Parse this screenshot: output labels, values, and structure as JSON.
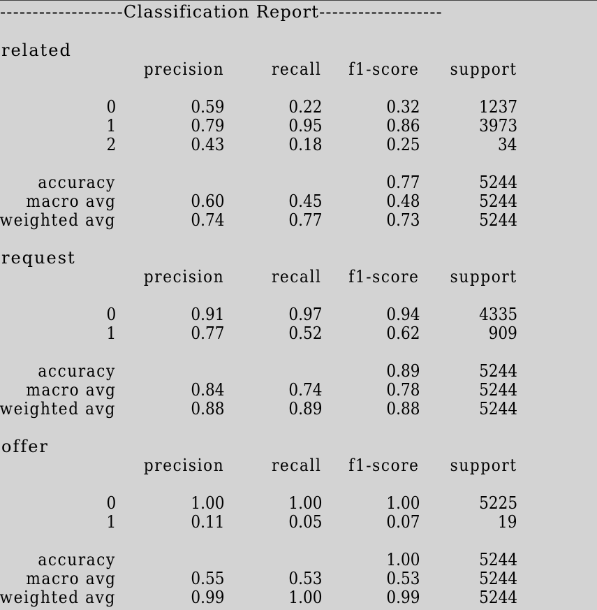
{
  "window": {
    "background": "#d3d3d3"
  },
  "report": {
    "title_line": "-------------------Classification Report-------------------",
    "header": {
      "precision": "precision",
      "recall": "recall",
      "f1": "f1-score",
      "support": "support"
    },
    "sections": [
      {
        "name": "related",
        "classes": [
          {
            "label": "0",
            "precision": "0.59",
            "recall": "0.22",
            "f1": "0.32",
            "support": "1237"
          },
          {
            "label": "1",
            "precision": "0.79",
            "recall": "0.95",
            "f1": "0.86",
            "support": "3973"
          },
          {
            "label": "2",
            "precision": "0.43",
            "recall": "0.18",
            "f1": "0.25",
            "support": "34"
          }
        ],
        "accuracy": {
          "label": "accuracy",
          "f1": "0.77",
          "support": "5244"
        },
        "macro": {
          "label": "macro avg",
          "precision": "0.60",
          "recall": "0.45",
          "f1": "0.48",
          "support": "5244"
        },
        "weighted": {
          "label": "weighted avg",
          "precision": "0.74",
          "recall": "0.77",
          "f1": "0.73",
          "support": "5244"
        }
      },
      {
        "name": "request",
        "classes": [
          {
            "label": "0",
            "precision": "0.91",
            "recall": "0.97",
            "f1": "0.94",
            "support": "4335"
          },
          {
            "label": "1",
            "precision": "0.77",
            "recall": "0.52",
            "f1": "0.62",
            "support": "909"
          }
        ],
        "accuracy": {
          "label": "accuracy",
          "f1": "0.89",
          "support": "5244"
        },
        "macro": {
          "label": "macro avg",
          "precision": "0.84",
          "recall": "0.74",
          "f1": "0.78",
          "support": "5244"
        },
        "weighted": {
          "label": "weighted avg",
          "precision": "0.88",
          "recall": "0.89",
          "f1": "0.88",
          "support": "5244"
        }
      },
      {
        "name": "offer",
        "classes": [
          {
            "label": "0",
            "precision": "1.00",
            "recall": "1.00",
            "f1": "1.00",
            "support": "5225"
          },
          {
            "label": "1",
            "precision": "0.11",
            "recall": "0.05",
            "f1": "0.07",
            "support": "19"
          }
        ],
        "accuracy": {
          "label": "accuracy",
          "f1": "1.00",
          "support": "5244"
        },
        "macro": {
          "label": "macro avg",
          "precision": "0.55",
          "recall": "0.53",
          "f1": "0.53",
          "support": "5244"
        },
        "weighted": {
          "label": "weighted avg",
          "precision": "0.99",
          "recall": "1.00",
          "f1": "0.99",
          "support": "5244"
        }
      }
    ]
  }
}
